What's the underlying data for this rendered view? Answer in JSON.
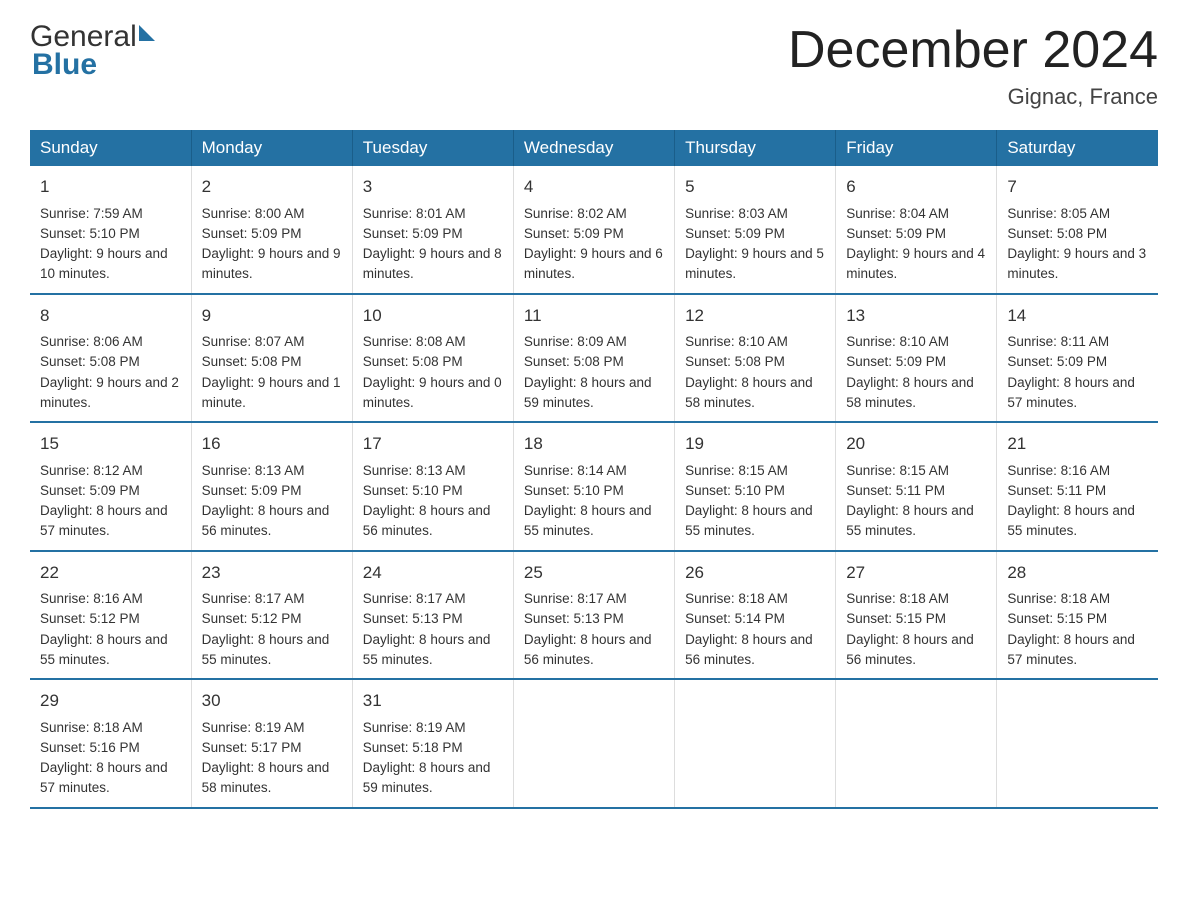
{
  "header": {
    "logo_general": "General",
    "logo_blue": "Blue",
    "month_title": "December 2024",
    "location": "Gignac, France"
  },
  "days_of_week": [
    "Sunday",
    "Monday",
    "Tuesday",
    "Wednesday",
    "Thursday",
    "Friday",
    "Saturday"
  ],
  "weeks": [
    [
      {
        "day": "1",
        "sunrise": "7:59 AM",
        "sunset": "5:10 PM",
        "daylight": "9 hours and 10 minutes."
      },
      {
        "day": "2",
        "sunrise": "8:00 AM",
        "sunset": "5:09 PM",
        "daylight": "9 hours and 9 minutes."
      },
      {
        "day": "3",
        "sunrise": "8:01 AM",
        "sunset": "5:09 PM",
        "daylight": "9 hours and 8 minutes."
      },
      {
        "day": "4",
        "sunrise": "8:02 AM",
        "sunset": "5:09 PM",
        "daylight": "9 hours and 6 minutes."
      },
      {
        "day": "5",
        "sunrise": "8:03 AM",
        "sunset": "5:09 PM",
        "daylight": "9 hours and 5 minutes."
      },
      {
        "day": "6",
        "sunrise": "8:04 AM",
        "sunset": "5:09 PM",
        "daylight": "9 hours and 4 minutes."
      },
      {
        "day": "7",
        "sunrise": "8:05 AM",
        "sunset": "5:08 PM",
        "daylight": "9 hours and 3 minutes."
      }
    ],
    [
      {
        "day": "8",
        "sunrise": "8:06 AM",
        "sunset": "5:08 PM",
        "daylight": "9 hours and 2 minutes."
      },
      {
        "day": "9",
        "sunrise": "8:07 AM",
        "sunset": "5:08 PM",
        "daylight": "9 hours and 1 minute."
      },
      {
        "day": "10",
        "sunrise": "8:08 AM",
        "sunset": "5:08 PM",
        "daylight": "9 hours and 0 minutes."
      },
      {
        "day": "11",
        "sunrise": "8:09 AM",
        "sunset": "5:08 PM",
        "daylight": "8 hours and 59 minutes."
      },
      {
        "day": "12",
        "sunrise": "8:10 AM",
        "sunset": "5:08 PM",
        "daylight": "8 hours and 58 minutes."
      },
      {
        "day": "13",
        "sunrise": "8:10 AM",
        "sunset": "5:09 PM",
        "daylight": "8 hours and 58 minutes."
      },
      {
        "day": "14",
        "sunrise": "8:11 AM",
        "sunset": "5:09 PM",
        "daylight": "8 hours and 57 minutes."
      }
    ],
    [
      {
        "day": "15",
        "sunrise": "8:12 AM",
        "sunset": "5:09 PM",
        "daylight": "8 hours and 57 minutes."
      },
      {
        "day": "16",
        "sunrise": "8:13 AM",
        "sunset": "5:09 PM",
        "daylight": "8 hours and 56 minutes."
      },
      {
        "day": "17",
        "sunrise": "8:13 AM",
        "sunset": "5:10 PM",
        "daylight": "8 hours and 56 minutes."
      },
      {
        "day": "18",
        "sunrise": "8:14 AM",
        "sunset": "5:10 PM",
        "daylight": "8 hours and 55 minutes."
      },
      {
        "day": "19",
        "sunrise": "8:15 AM",
        "sunset": "5:10 PM",
        "daylight": "8 hours and 55 minutes."
      },
      {
        "day": "20",
        "sunrise": "8:15 AM",
        "sunset": "5:11 PM",
        "daylight": "8 hours and 55 minutes."
      },
      {
        "day": "21",
        "sunrise": "8:16 AM",
        "sunset": "5:11 PM",
        "daylight": "8 hours and 55 minutes."
      }
    ],
    [
      {
        "day": "22",
        "sunrise": "8:16 AM",
        "sunset": "5:12 PM",
        "daylight": "8 hours and 55 minutes."
      },
      {
        "day": "23",
        "sunrise": "8:17 AM",
        "sunset": "5:12 PM",
        "daylight": "8 hours and 55 minutes."
      },
      {
        "day": "24",
        "sunrise": "8:17 AM",
        "sunset": "5:13 PM",
        "daylight": "8 hours and 55 minutes."
      },
      {
        "day": "25",
        "sunrise": "8:17 AM",
        "sunset": "5:13 PM",
        "daylight": "8 hours and 56 minutes."
      },
      {
        "day": "26",
        "sunrise": "8:18 AM",
        "sunset": "5:14 PM",
        "daylight": "8 hours and 56 minutes."
      },
      {
        "day": "27",
        "sunrise": "8:18 AM",
        "sunset": "5:15 PM",
        "daylight": "8 hours and 56 minutes."
      },
      {
        "day": "28",
        "sunrise": "8:18 AM",
        "sunset": "5:15 PM",
        "daylight": "8 hours and 57 minutes."
      }
    ],
    [
      {
        "day": "29",
        "sunrise": "8:18 AM",
        "sunset": "5:16 PM",
        "daylight": "8 hours and 57 minutes."
      },
      {
        "day": "30",
        "sunrise": "8:19 AM",
        "sunset": "5:17 PM",
        "daylight": "8 hours and 58 minutes."
      },
      {
        "day": "31",
        "sunrise": "8:19 AM",
        "sunset": "5:18 PM",
        "daylight": "8 hours and 59 minutes."
      },
      null,
      null,
      null,
      null
    ]
  ],
  "labels": {
    "sunrise": "Sunrise:",
    "sunset": "Sunset:",
    "daylight": "Daylight:"
  }
}
